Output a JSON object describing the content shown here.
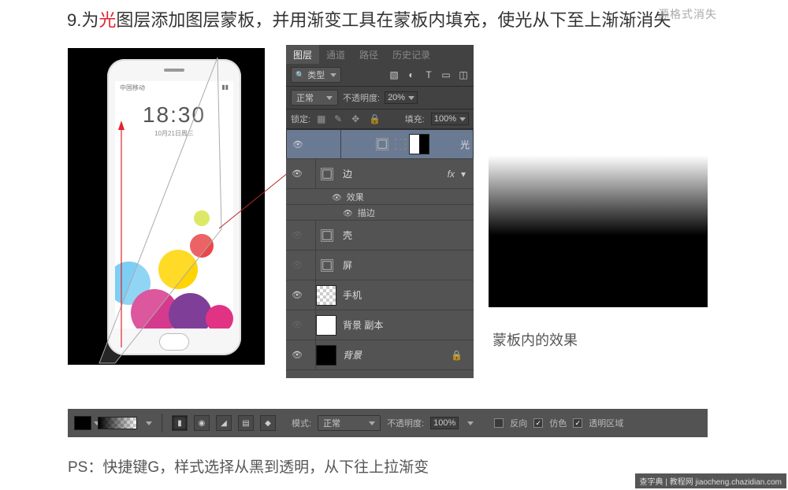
{
  "step": {
    "number": "9.",
    "prefix": "为",
    "highlight": "光",
    "rest": "图层添加图层蒙板，并用渐变工具在蒙板内填充，使光从下至上渐渐消失"
  },
  "watermark_top": "源格式消失",
  "phone": {
    "time": "18:30",
    "date": "10月21日周三",
    "status_left": "中国移动",
    "status_right": "▮▮"
  },
  "panel": {
    "tabs": [
      "图层",
      "通道",
      "路径",
      "历史记录"
    ],
    "active_tab": 0,
    "filter_label": "类型",
    "blend_mode": "正常",
    "opacity_label": "不透明度:",
    "opacity_value": "20%",
    "lock_label": "锁定:",
    "fill_label": "填充:",
    "fill_value": "100%",
    "layers": [
      {
        "name": "光",
        "visible": true,
        "selected": true
      },
      {
        "name": "边",
        "visible": true,
        "fx": "fx"
      },
      {
        "effects_label": "效果",
        "stroke_label": "描边"
      },
      {
        "name": "壳",
        "visible": false
      },
      {
        "name": "屏",
        "visible": false
      },
      {
        "name": "手机",
        "visible": true
      },
      {
        "name": "背景 副本",
        "visible": false
      },
      {
        "name": "背景",
        "visible": true,
        "locked": true
      }
    ]
  },
  "mask_caption": "蒙板内的效果",
  "toolbar": {
    "mode_label": "模式:",
    "mode_value": "正常",
    "opacity_label": "不透明度:",
    "opacity_value": "100%",
    "reverse": "反向",
    "dither": "仿色",
    "transparency": "透明区域"
  },
  "ps_note": {
    "label": "PS：",
    "text": "快捷键G，样式选择从黑到透明，从下往上拉渐变"
  },
  "watermark_br": "查字典 | 教程网  jiaocheng.chazidian.com"
}
